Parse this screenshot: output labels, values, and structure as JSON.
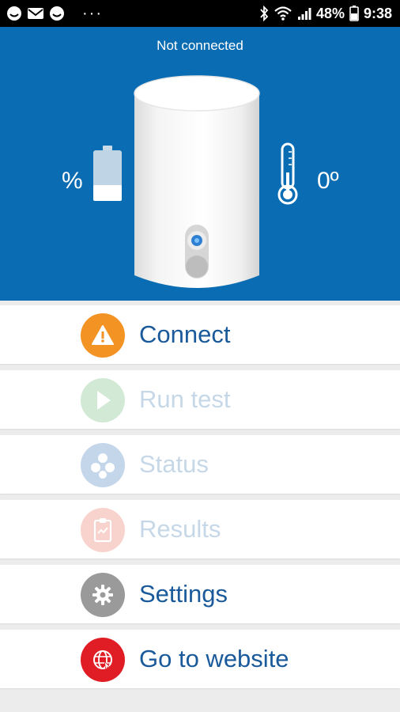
{
  "status_bar": {
    "icons_left": [
      "emoji-icon",
      "gmail-icon",
      "emoji-icon",
      "more-icon"
    ],
    "more": "···",
    "icons_right": [
      "bluetooth-icon",
      "wifi-icon",
      "signal-icon"
    ],
    "battery": "48%",
    "time": "9:38"
  },
  "hero": {
    "connection_status": "Not connected",
    "battery_percent": "%",
    "temperature": "0º",
    "background_color": "#0a6cb2"
  },
  "menu": {
    "items": [
      {
        "label": "Connect",
        "icon": "warning-icon",
        "icon_color": "#f39323",
        "enabled": true
      },
      {
        "label": "Run test",
        "icon": "play-icon",
        "icon_color": "#5db26a",
        "enabled": false
      },
      {
        "label": "Status",
        "icon": "status-dots-icon",
        "icon_color": "#2b6fb6",
        "enabled": false
      },
      {
        "label": "Results",
        "icon": "clipboard-icon",
        "icon_color": "#e8624a",
        "enabled": false
      },
      {
        "label": "Settings",
        "icon": "gear-icon",
        "icon_color": "#9a9a9a",
        "enabled": true
      },
      {
        "label": "Go to website",
        "icon": "globe-icon",
        "icon_color": "#e01d24",
        "enabled": true
      }
    ]
  }
}
